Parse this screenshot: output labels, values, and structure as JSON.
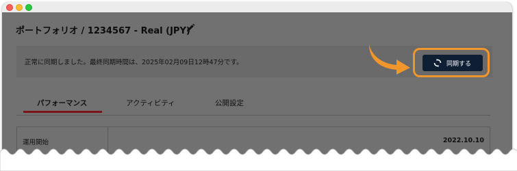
{
  "window": {
    "controls": [
      "close-button",
      "minimize-button",
      "maximize-button"
    ]
  },
  "header": {
    "title": "ポートフォリオ / 1234567 - Real (JPY)",
    "edit_icon": "pencil-icon"
  },
  "notice": {
    "message": "正常に同期しました。最終同期時間は、2025年02月09日12時47分です。"
  },
  "sync": {
    "label": "同期する",
    "icon": "sync-icon",
    "highlight_color": "#f0962a",
    "button_color": "#0f1f33"
  },
  "tabs": [
    {
      "label": "パフォーマンス",
      "active": true
    },
    {
      "label": "アクティビティ",
      "active": false
    },
    {
      "label": "公開設定",
      "active": false
    }
  ],
  "details": {
    "rows": [
      {
        "label": "運用開始",
        "value": "2022.10.10"
      }
    ]
  },
  "colors": {
    "tab_active_underline": "#7a1418",
    "overlay": "#717171"
  }
}
